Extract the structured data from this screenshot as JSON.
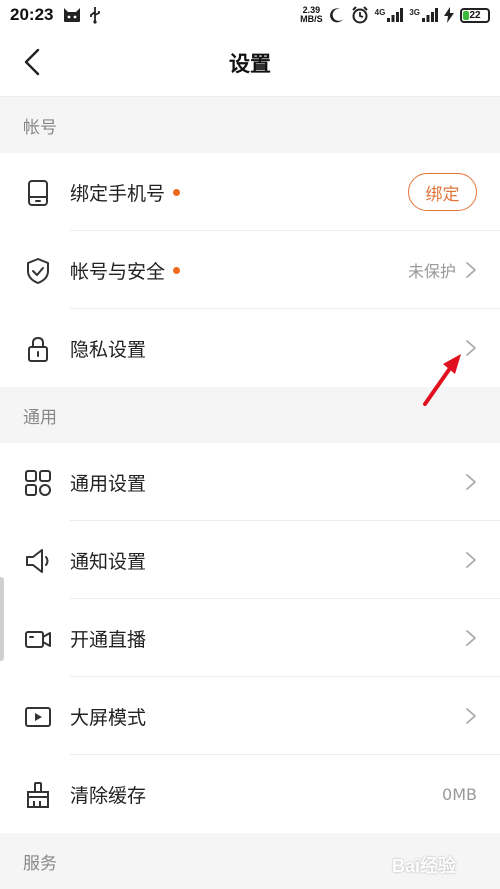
{
  "status_bar": {
    "time": "20:23",
    "net_speed_value": "2.39",
    "net_speed_unit": "MB/S",
    "signal_1_label": "4G",
    "signal_2_label": "3G",
    "battery_level": "22",
    "battery_fraction": 0.22
  },
  "header": {
    "title": "设置",
    "back_icon": "chevron-left-icon"
  },
  "sections": {
    "account": {
      "title": "帐号",
      "items": [
        {
          "label": "绑定手机号",
          "icon": "phone-icon",
          "has_dot": true,
          "action_label": "绑定"
        },
        {
          "label": "帐号与安全",
          "icon": "shield-icon",
          "has_dot": true,
          "value": "未保护"
        },
        {
          "label": "隐私设置",
          "icon": "lock-icon",
          "has_dot": false
        }
      ]
    },
    "general": {
      "title": "通用",
      "items": [
        {
          "label": "通用设置",
          "icon": "grid-icon"
        },
        {
          "label": "通知设置",
          "icon": "speaker-icon"
        },
        {
          "label": "开通直播",
          "icon": "video-camera-icon"
        },
        {
          "label": "大屏模式",
          "icon": "play-screen-icon"
        },
        {
          "label": "清除缓存",
          "icon": "broom-icon",
          "value": "0MB"
        }
      ]
    },
    "service": {
      "title": "服务"
    }
  },
  "colors": {
    "accent": "#e2753a",
    "dot": "#f06a1c",
    "annotation_arrow": "#e0101e",
    "battery": "#3cb93c"
  },
  "watermark_text": "Bai经验"
}
